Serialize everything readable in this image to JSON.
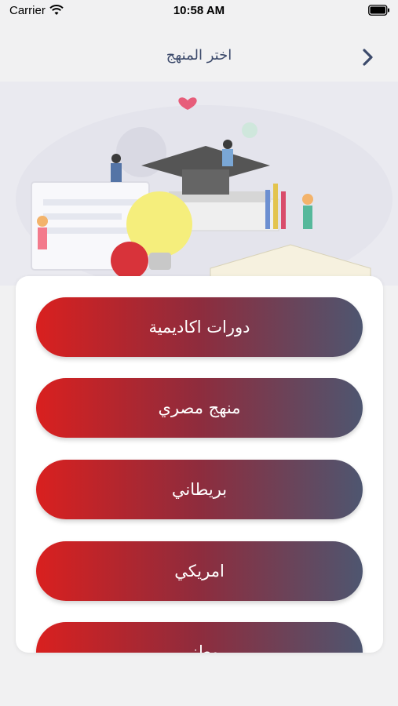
{
  "status_bar": {
    "carrier": "Carrier",
    "time": "10:58 AM"
  },
  "header": {
    "title": "اختر المنهج"
  },
  "options": [
    {
      "label": "دورات اكاديمية"
    },
    {
      "label": "منهج مصري"
    },
    {
      "label": "بريطاني"
    },
    {
      "label": "امريكي"
    },
    {
      "label": "وطني"
    }
  ],
  "colors": {
    "gradient_start": "#d9201f",
    "gradient_mid": "#8e2c3d",
    "gradient_end": "#4e5670",
    "title_color": "#3c4a6b"
  },
  "icons": [
    "wifi-icon",
    "battery-icon",
    "chevron-right-icon"
  ]
}
